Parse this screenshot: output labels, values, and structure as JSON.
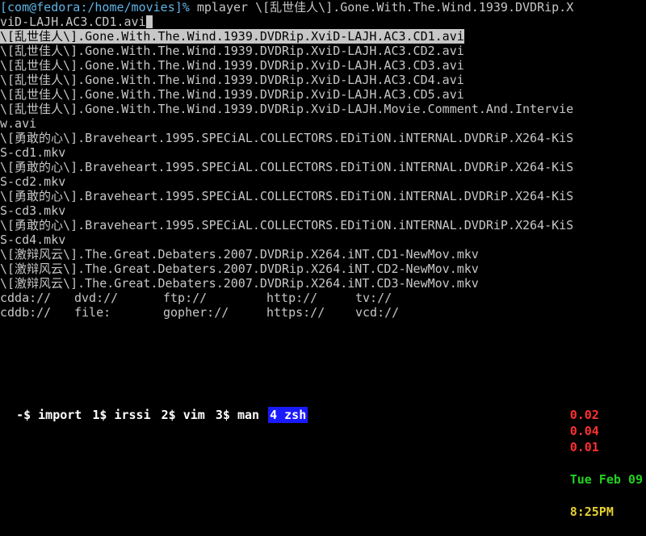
{
  "prompt": {
    "text": "[com@fedora:/home/movies]%",
    "command_line_1": " mplayer \\[乱世佳人\\].Gone.With.The.Wind.1939.DVDRip.X",
    "command_line_2": "viD-LAJH.AC3.CD1.avi"
  },
  "output_lines": [
    "\\[乱世佳人\\].Gone.With.The.Wind.1939.DVDRip.XviD-LAJH.AC3.CD1.avi",
    "\\[乱世佳人\\].Gone.With.The.Wind.1939.DVDRip.XviD-LAJH.AC3.CD2.avi",
    "\\[乱世佳人\\].Gone.With.The.Wind.1939.DVDRip.XviD-LAJH.AC3.CD3.avi",
    "\\[乱世佳人\\].Gone.With.The.Wind.1939.DVDRip.XviD-LAJH.AC3.CD4.avi",
    "\\[乱世佳人\\].Gone.With.The.Wind.1939.DVDRip.XviD-LAJH.AC3.CD5.avi",
    "\\[乱世佳人\\].Gone.With.The.Wind.1939.DVDRip.XviD-LAJH.Movie.Comment.And.Intervie",
    "w.avi",
    "\\[勇敢的心\\].Braveheart.1995.SPECiAL.COLLECTORS.EDiTiON.iNTERNAL.DVDRiP.X264-KiS",
    "S-cd1.mkv",
    "\\[勇敢的心\\].Braveheart.1995.SPECiAL.COLLECTORS.EDiTiON.iNTERNAL.DVDRiP.X264-KiS",
    "S-cd2.mkv",
    "\\[勇敢的心\\].Braveheart.1995.SPECiAL.COLLECTORS.EDiTiON.iNTERNAL.DVDRiP.X264-KiS",
    "S-cd3.mkv",
    "\\[勇敢的心\\].Braveheart.1995.SPECiAL.COLLECTORS.EDiTiON.iNTERNAL.DVDRiP.X264-KiS",
    "S-cd4.mkv",
    "\\[激辩风云\\].The.Great.Debaters.2007.DVDRip.X264.iNT.CD1-NewMov.mkv",
    "\\[激辩风云\\].The.Great.Debaters.2007.DVDRip.X264.iNT.CD2-NewMov.mkv",
    "\\[激辩风云\\].The.Great.Debaters.2007.DVDRip.X264.iNT.CD3-NewMov.mkv"
  ],
  "url_completions": [
    [
      "cdda://",
      "dvd://",
      "ftp://",
      "http://",
      "tv://"
    ],
    [
      "cddb://",
      "file:",
      "gopher://",
      "https://",
      "vcd://"
    ]
  ],
  "statusbar": {
    "windows": [
      {
        "label": "-$ import",
        "active": false
      },
      {
        "label": "1$ irssi",
        "active": false
      },
      {
        "label": "2$ vim",
        "active": false
      },
      {
        "label": "3$ man",
        "active": false
      },
      {
        "label": "4 zsh",
        "active": true
      }
    ],
    "load": [
      "0.02",
      "0.04",
      "0.01"
    ],
    "date": "Tue Feb 09",
    "time": "8:25PM"
  },
  "colors": {
    "prompt": "#5fb4e6",
    "text": "#c7c7c7",
    "active_window_bg": "#1a1aff",
    "load": "#ff3030",
    "date": "#22d022",
    "time": "#e5d030"
  }
}
